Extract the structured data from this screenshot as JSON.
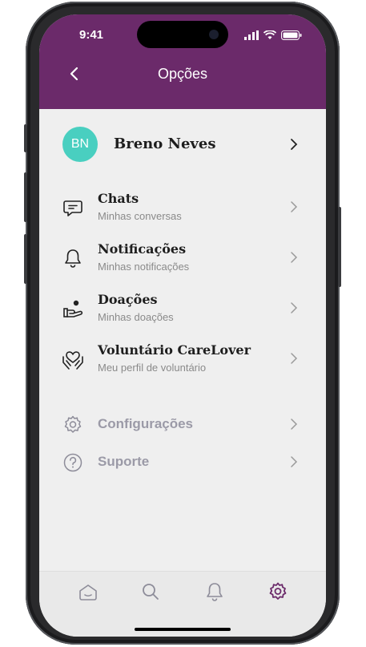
{
  "status_bar": {
    "time": "9:41"
  },
  "header": {
    "title": "Opções",
    "background": "#6b2a6a"
  },
  "profile": {
    "initials": "BN",
    "name": "Breno Neves",
    "avatar_color": "#49cfc0"
  },
  "menu": [
    {
      "label": "Chats",
      "subtitle": "Minhas conversas",
      "icon": "chat-icon"
    },
    {
      "label": "Notificações",
      "subtitle": "Minhas notificações",
      "icon": "bell-icon"
    },
    {
      "label": "Doações",
      "subtitle": "Minhas doações",
      "icon": "donation-hand-icon"
    },
    {
      "label": "Voluntário CareLover",
      "subtitle": "Meu perfil de voluntário",
      "icon": "volunteer-heart-icon"
    }
  ],
  "secondary": [
    {
      "label": "Configurações",
      "icon": "gear-icon"
    },
    {
      "label": "Suporte",
      "icon": "question-icon"
    }
  ],
  "tabbar": {
    "tabs": [
      "home-icon",
      "search-icon",
      "bell-icon",
      "gear-icon"
    ],
    "active": "gear-icon",
    "active_color": "#6b2a6a"
  }
}
